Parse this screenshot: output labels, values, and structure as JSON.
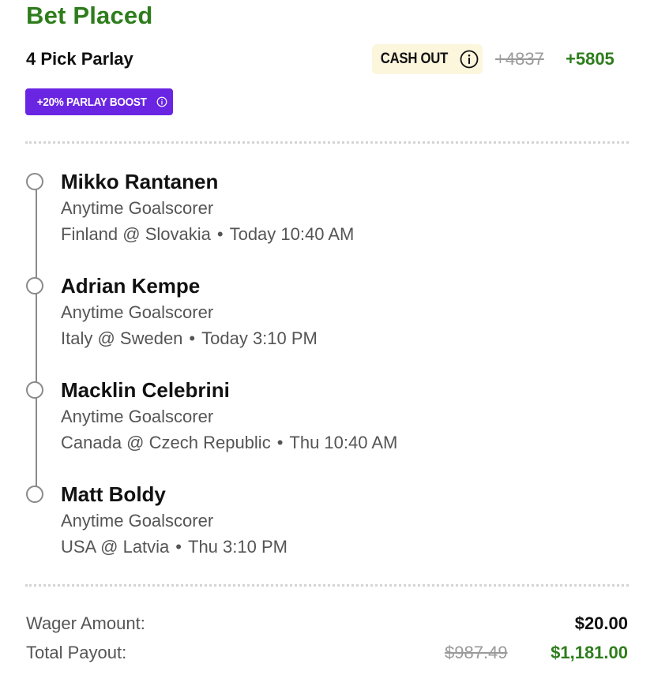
{
  "header": {
    "title": "Bet Placed",
    "bet_type": "4 Pick Parlay"
  },
  "cash_out": {
    "label": "CASH OUT",
    "icon": "info-icon"
  },
  "odds": {
    "original": "+4837",
    "boosted": "+5805"
  },
  "boost": {
    "label": "+20% PARLAY BOOST",
    "icon": "info-icon"
  },
  "legs": [
    {
      "player": "Mikko Rantanen",
      "market": "Anytime Goalscorer",
      "matchup": "Finland @ Slovakia",
      "time": "Today 10:40 AM"
    },
    {
      "player": "Adrian Kempe",
      "market": "Anytime Goalscorer",
      "matchup": "Italy @ Sweden",
      "time": "Today 3:10 PM"
    },
    {
      "player": "Macklin Celebrini",
      "market": "Anytime Goalscorer",
      "matchup": "Canada @ Czech Republic",
      "time": "Thu 10:40 AM"
    },
    {
      "player": "Matt Boldy",
      "market": "Anytime Goalscorer",
      "matchup": "USA @ Latvia",
      "time": "Thu 3:10 PM"
    }
  ],
  "summary": {
    "wager_label": "Wager Amount:",
    "wager_value": "$20.00",
    "payout_label": "Total Payout:",
    "payout_original": "$987.49",
    "payout_boosted": "$1,181.00"
  },
  "colors": {
    "accent_green": "#2e7d1c",
    "boost_purple": "#6a25e3",
    "cashout_bg": "#fcf6dd",
    "strike_gray": "#9a9a9a"
  }
}
